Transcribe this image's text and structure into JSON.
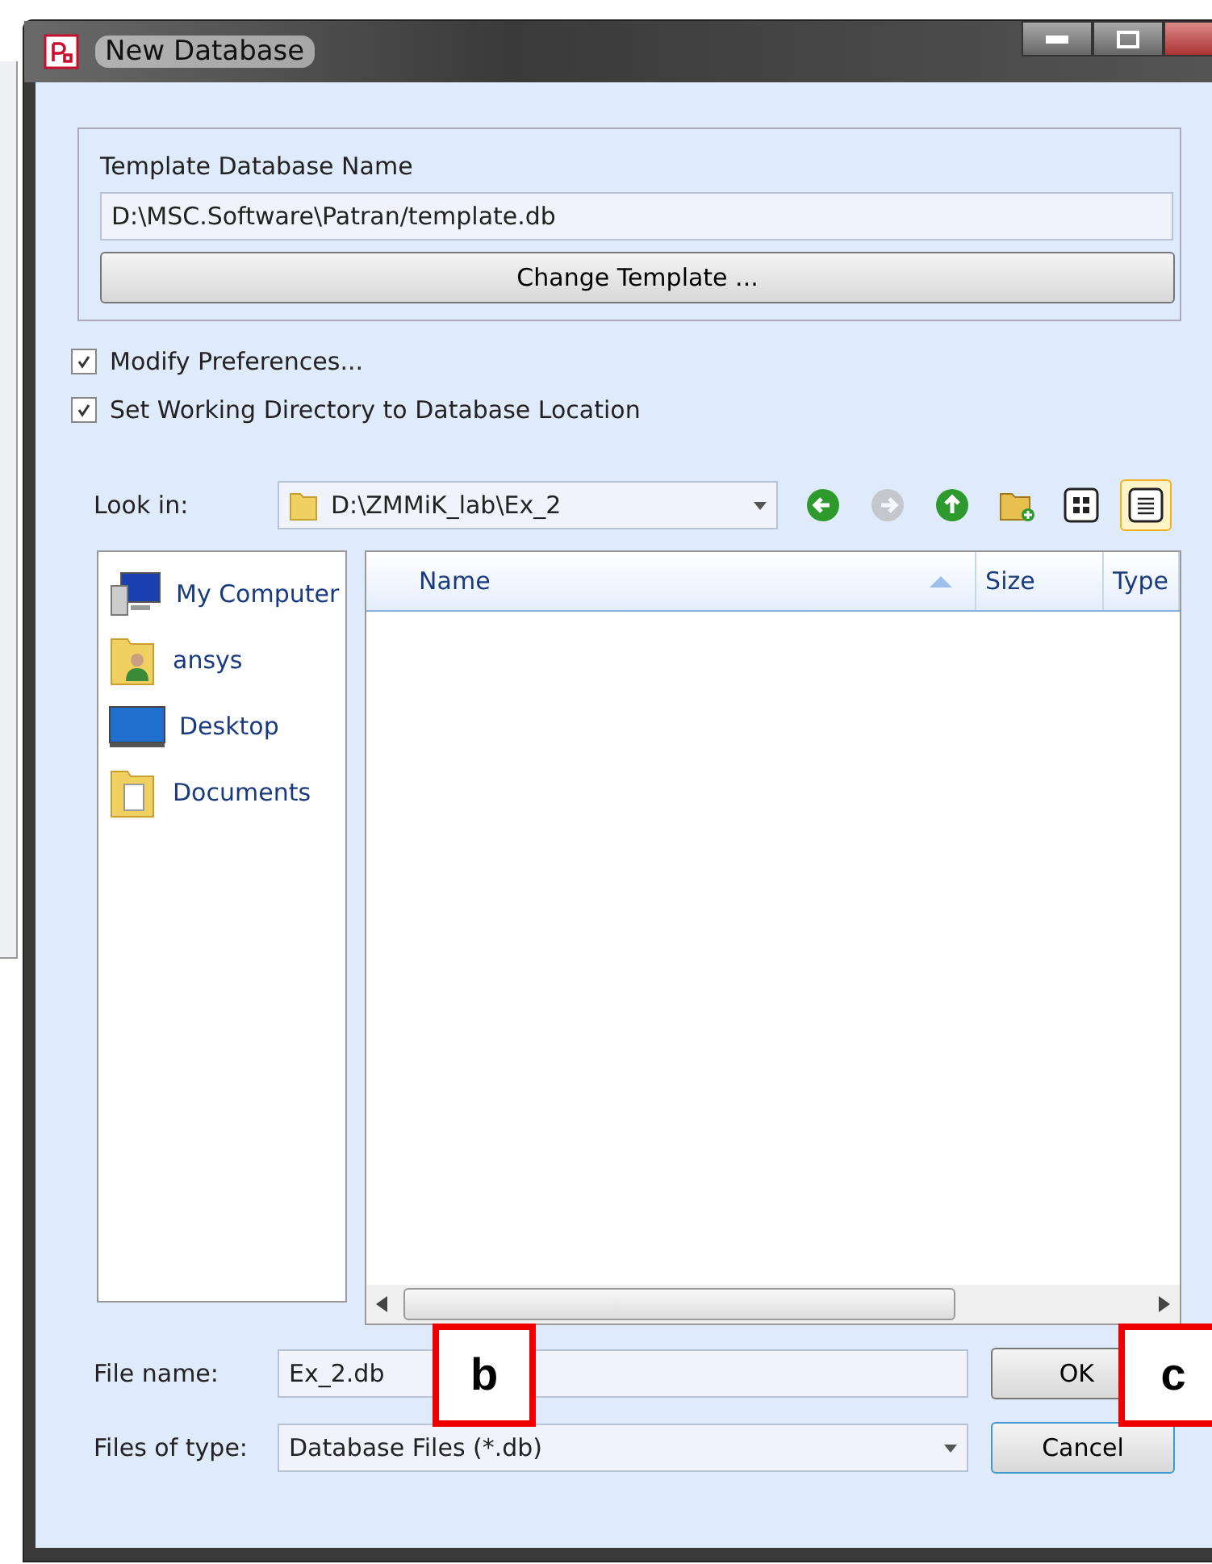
{
  "window": {
    "title": "New Database"
  },
  "template": {
    "label": "Template Database Name",
    "value": "D:\\MSC.Software\\Patran/template.db",
    "button": "Change Template ..."
  },
  "options": [
    {
      "label": "Modify Preferences...",
      "checked": true
    },
    {
      "label": "Set Working Directory to Database Location",
      "checked": true
    }
  ],
  "look_in": {
    "label": "Look in:",
    "value": "D:\\ZMMiK_lab\\Ex_2"
  },
  "toolbar": [
    {
      "kind": "back",
      "disabled": false,
      "selected": false
    },
    {
      "kind": "forward",
      "disabled": true,
      "selected": false
    },
    {
      "kind": "up",
      "disabled": false,
      "selected": false
    },
    {
      "kind": "newfolder",
      "disabled": false,
      "selected": false
    },
    {
      "kind": "list",
      "disabled": false,
      "selected": false
    },
    {
      "kind": "detail",
      "disabled": false,
      "selected": true
    }
  ],
  "places": [
    {
      "label": "My Computer",
      "kind": "computer"
    },
    {
      "label": "ansys",
      "kind": "user"
    },
    {
      "label": "Desktop",
      "kind": "desktop"
    },
    {
      "label": "Documents",
      "kind": "documents"
    }
  ],
  "columns": [
    "Name",
    "Size",
    "Type"
  ],
  "file_name": {
    "label": "File name:",
    "value": "Ex_2.db"
  },
  "file_type": {
    "label": "Files of type:",
    "value": "Database Files (*.db)"
  },
  "buttons": [
    "OK",
    "Cancel"
  ],
  "annotations": [
    "b",
    "c"
  ]
}
